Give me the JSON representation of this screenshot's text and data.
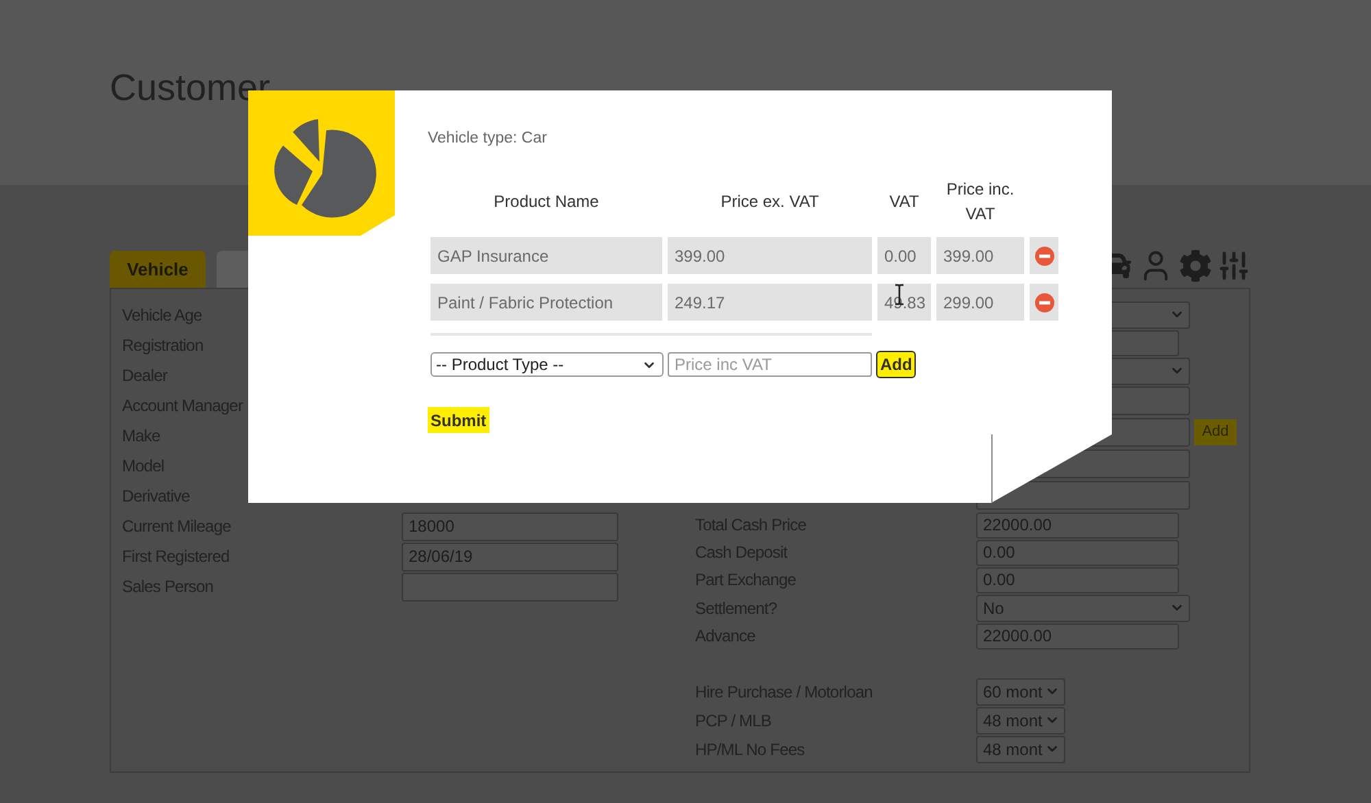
{
  "page": {
    "title": "Customer"
  },
  "tabs": [
    {
      "label": "Vehicle",
      "selected": true
    },
    {
      "selected": false
    }
  ],
  "form": {
    "left_rows": [
      {
        "label": "Vehicle Age"
      },
      {
        "label": "Registration"
      },
      {
        "label": "Dealer"
      },
      {
        "label": "Account Manager"
      },
      {
        "label": "Make"
      },
      {
        "label": "Model"
      },
      {
        "label": "Derivative"
      },
      {
        "label": "Current Mileage",
        "field": {
          "kind": "input",
          "value": "18000"
        }
      },
      {
        "label": "First Registered",
        "field": {
          "kind": "input",
          "value": "28/06/19"
        }
      },
      {
        "label": "Sales Person",
        "field": {
          "kind": "input"
        }
      }
    ],
    "right_rows": [
      {
        "field": {
          "kind": "select"
        }
      },
      {
        "field": {
          "kind": "input"
        }
      },
      {
        "field": {
          "kind": "select"
        }
      },
      {
        "field": {
          "kind": "wideinput"
        }
      },
      {
        "field": {
          "kind": "wideinput",
          "button": "Add"
        }
      },
      {
        "field": {
          "kind": "wideinput"
        }
      },
      {
        "field": {
          "kind": "wideinput"
        }
      },
      {
        "label": "Total Cash Price",
        "field": {
          "kind": "input",
          "value": "22000.00"
        }
      },
      {
        "label": "Cash Deposit",
        "field": {
          "kind": "input",
          "value": "0.00"
        }
      },
      {
        "label": "Part Exchange",
        "field": {
          "kind": "input",
          "value": "0.00"
        }
      },
      {
        "label": "Settlement?",
        "field": {
          "kind": "select",
          "value": "No"
        }
      },
      {
        "label": "Advance",
        "field": {
          "kind": "input",
          "value": "22000.00"
        }
      }
    ],
    "term_rows": [
      {
        "label": "Hire Purchase / Motorloan",
        "field": {
          "kind": "smallselect",
          "value": "60 mont"
        }
      },
      {
        "label": "PCP / MLB",
        "field": {
          "kind": "smallselect",
          "value": "48 mont"
        }
      },
      {
        "label": "HP/ML No Fees",
        "field": {
          "kind": "smallselect",
          "value": "48 mont"
        }
      }
    ]
  },
  "modal": {
    "vehicle_type": "Vehicle type: Car",
    "columns": [
      "Product Name",
      "Price ex. VAT",
      "VAT",
      "Price inc. VAT"
    ],
    "rows": [
      {
        "cells": [
          "GAP Insurance",
          "399.00",
          "0.00",
          "399.00"
        ]
      },
      {
        "cells": [
          "Paint / Fabric Protection",
          "249.17",
          "49.83",
          "299.00"
        ]
      }
    ],
    "product_select": {
      "value": "-- Product Type --"
    },
    "price_field": {
      "placeholder": "Price inc VAT"
    },
    "add_button": "Add",
    "submit_button": "Submit"
  }
}
